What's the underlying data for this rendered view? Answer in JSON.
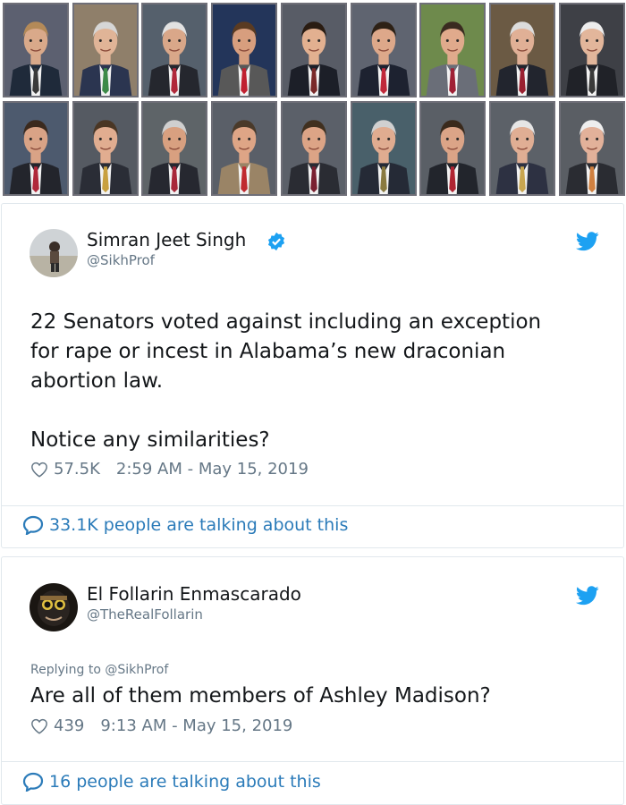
{
  "photo_grid": {
    "portraits": [
      {
        "face": "#d9a98a",
        "hair": "#b48a58",
        "suit": "#1f2a3a",
        "tie": "#3a3a3a",
        "bg": "#5c6070"
      },
      {
        "face": "#e0b497",
        "hair": "#d6d6d6",
        "suit": "#2b3550",
        "tie": "#3d8a48",
        "bg": "#8f7f6a"
      },
      {
        "face": "#d9a789",
        "hair": "#e2e2e2",
        "suit": "#25272e",
        "tie": "#b0283a",
        "bg": "#55606c"
      },
      {
        "face": "#d79e7e",
        "hair": "#5a3b22",
        "suit": "#585858",
        "tie": "#c02030",
        "bg": "#23355a"
      },
      {
        "face": "#e2b090",
        "hair": "#2a1c12",
        "suit": "#1c1f28",
        "tie": "#7a2a2a",
        "bg": "#585c66"
      },
      {
        "face": "#dda88a",
        "hair": "#2d2116",
        "suit": "#1d2230",
        "tie": "#c0283a",
        "bg": "#5f6470"
      },
      {
        "face": "#e0aa8c",
        "hair": "#3a2b20",
        "suit": "#6a6e78",
        "tie": "#a02035",
        "bg": "#6e8a4c"
      },
      {
        "face": "#e0b096",
        "hair": "#dcdcdc",
        "suit": "#22252e",
        "tie": "#9a2030",
        "bg": "#6b5a44"
      },
      {
        "face": "#e2b69b",
        "hair": "#ededed",
        "suit": "#202228",
        "tie": "#3a3a3a",
        "bg": "#3e4046"
      },
      {
        "face": "#d9a386",
        "hair": "#3b2a1e",
        "suit": "#23252c",
        "tie": "#b0283a",
        "bg": "#4d5a6e"
      },
      {
        "face": "#e1ad90",
        "hair": "#4a3624",
        "suit": "#2a2d36",
        "tie": "#c8a040",
        "bg": "#555a62"
      },
      {
        "face": "#d8a080",
        "hair": "#cfcfcf",
        "suit": "#262830",
        "tie": "#a8283a",
        "bg": "#5e6468"
      },
      {
        "face": "#dea586",
        "hair": "#4a3a2a",
        "suit": "#9a8466",
        "tie": "#c02a30",
        "bg": "#5a5f68"
      },
      {
        "face": "#dca486",
        "hair": "#40301f",
        "suit": "#2a2c33",
        "tie": "#7a2030",
        "bg": "#5b6069"
      },
      {
        "face": "#e0ac90",
        "hair": "#d0d0d0",
        "suit": "#252a36",
        "tie": "#8a7a40",
        "bg": "#49606a"
      },
      {
        "face": "#dba487",
        "hair": "#3a2a1c",
        "suit": "#22252c",
        "tie": "#b02432",
        "bg": "#5a5f66"
      },
      {
        "face": "#e0ae94",
        "hair": "#e6e6e6",
        "suit": "#2d3142",
        "tie": "#c9a650",
        "bg": "#5c6168"
      },
      {
        "face": "#e2b19a",
        "hair": "#eeeeee",
        "suit": "#2a2c32",
        "tie": "#d08040",
        "bg": "#5a5e64"
      }
    ]
  },
  "tweet1": {
    "author_name": "Simran Jeet Singh",
    "author_handle": "@SikhProf",
    "text": "22 Senators voted against including an exception\nfor rape or incest in Alabama’s new draconian\nabortion law.\n\nNotice any similarities?",
    "likes": "57.5K",
    "timestamp": "2:59 AM - May 15, 2019",
    "talking": "33.1K people are talking about this"
  },
  "tweet2": {
    "author_name": "El Follarin Enmascarado",
    "author_handle": "@TheRealFollarin",
    "replying_to": "Replying to @SikhProf",
    "text": "Are all of them members of Ashley Madison?",
    "likes": "439",
    "timestamp": "9:13 AM - May 15, 2019",
    "talking": "16 people are talking about this"
  },
  "icons": {
    "verified": "verified-badge-icon",
    "twitter": "twitter-bird-icon",
    "like": "heart-icon",
    "conversation": "speech-bubble-icon"
  },
  "colors": {
    "twitter_blue": "#1da1f2",
    "link_blue": "#2b7bb9",
    "secondary_text": "#657786",
    "border": "#e1e8ed"
  }
}
